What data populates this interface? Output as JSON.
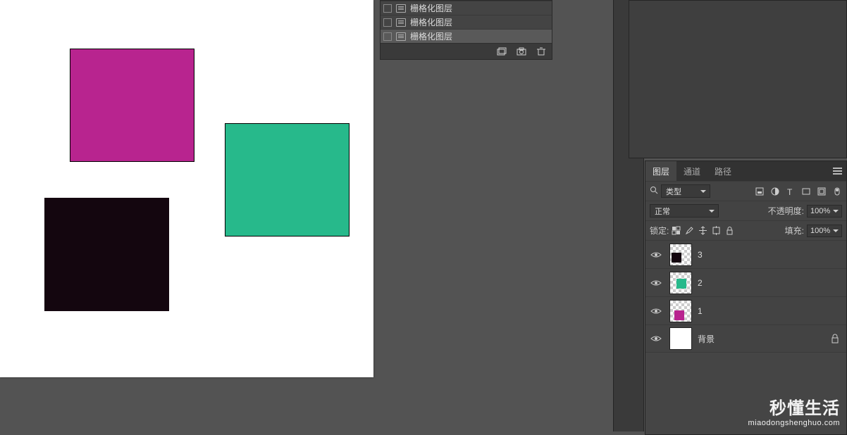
{
  "float_panel": {
    "rows": [
      "栅格化图层",
      "栅格化图层",
      "栅格化图层"
    ]
  },
  "panel_tabs": {
    "layers": "图层",
    "channels": "通道",
    "paths": "路径"
  },
  "search": {
    "icon": "🔍",
    "type_label": "类型"
  },
  "blend": {
    "mode": "正常",
    "opacity_label": "不透明度:",
    "opacity_value": "100%"
  },
  "lock": {
    "label": "锁定:",
    "fill_label": "填充:",
    "fill_value": "100%"
  },
  "layers": [
    {
      "name": "3"
    },
    {
      "name": "2"
    },
    {
      "name": "1"
    },
    {
      "name": "背景"
    }
  ],
  "watermark": {
    "big": "秒懂生活",
    "small": "miaodongshenghuo.com"
  }
}
